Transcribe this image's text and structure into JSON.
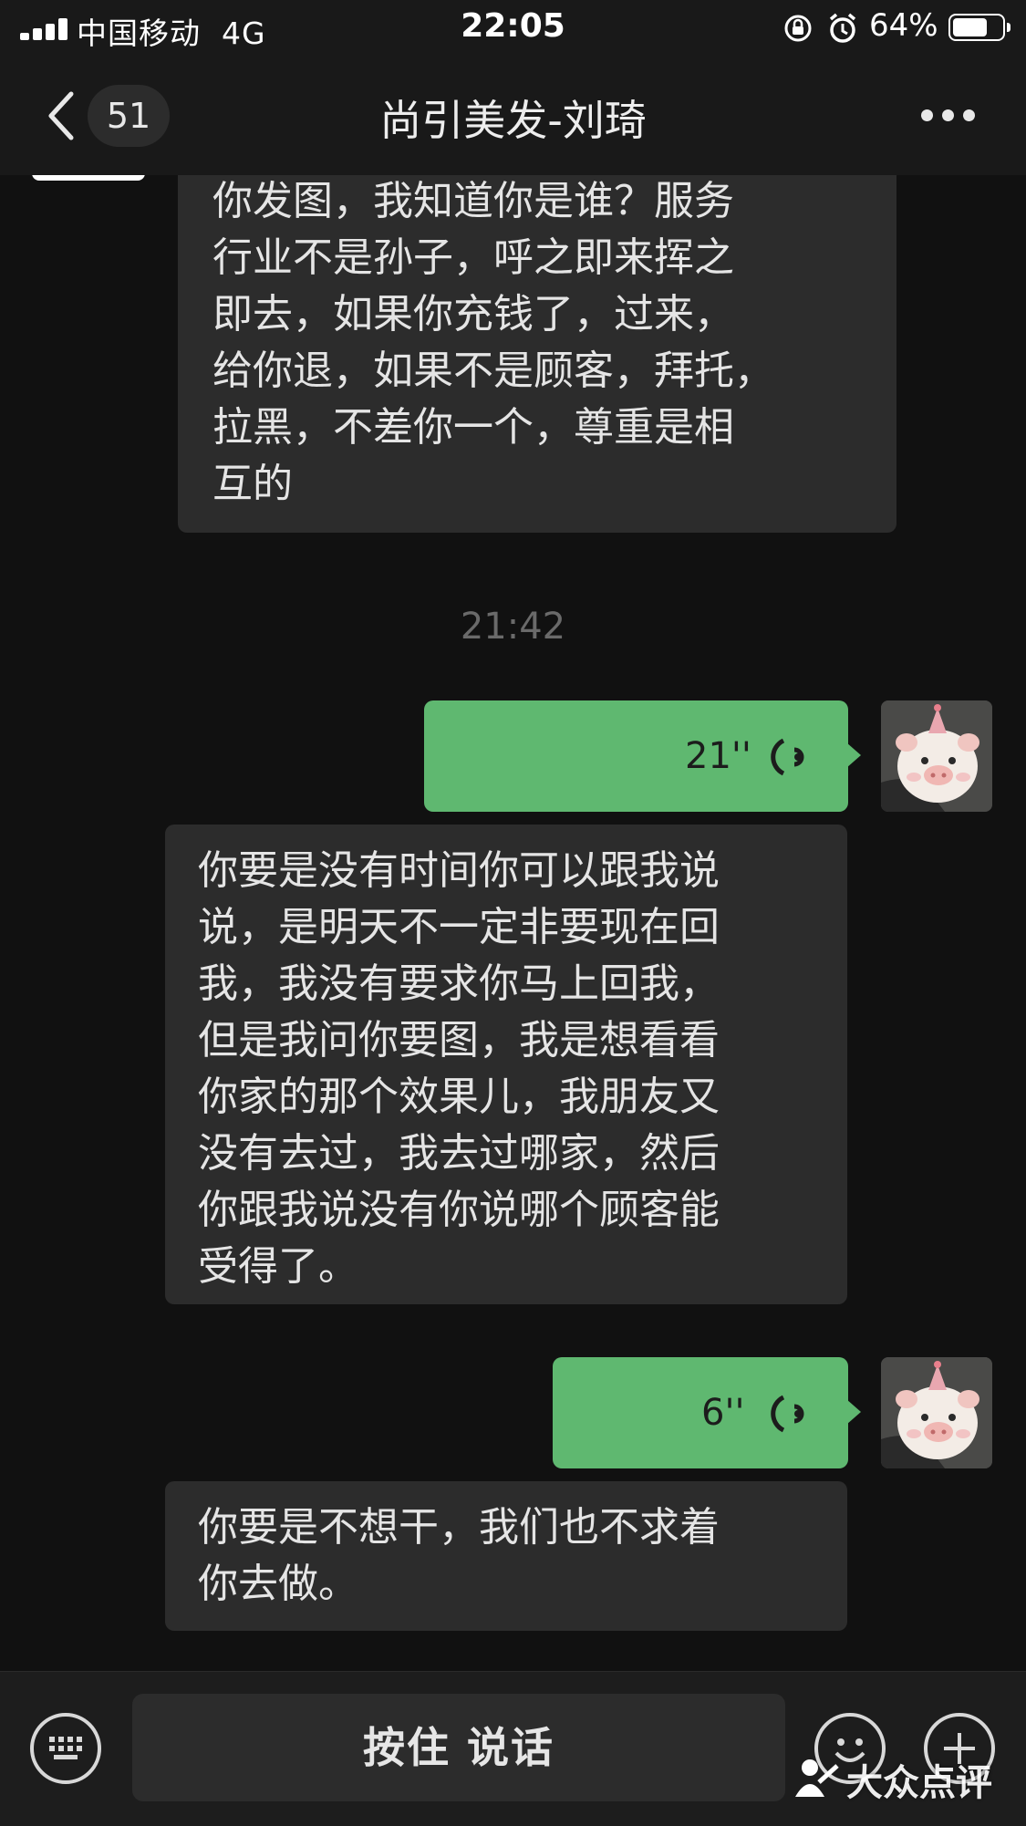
{
  "status_bar": {
    "carrier": "中国移动",
    "network": "4G",
    "time": "22:05",
    "battery_percent": "64%",
    "battery_level": 0.64
  },
  "header": {
    "unread_count": "51",
    "title": "尚引美发-刘琦",
    "icons": [
      "chevron-left-icon",
      "more-dots-icon"
    ]
  },
  "messages": [
    {
      "side": "left",
      "type": "text",
      "text": "你发图，我知道你是谁？服务\n行业不是孙子，呼之即来挥之\n即去，如果你充钱了，过来，\n给你退，如果不是顾客，拜托，\n拉黑，不差你一个，尊重是相\n互的"
    },
    {
      "type": "timestamp",
      "text": "21:42"
    },
    {
      "side": "right",
      "type": "voice",
      "duration": "21''"
    },
    {
      "side": "left",
      "type": "text",
      "text": "你要是没有时间你可以跟我说\n说，是明天不一定非要现在回\n我，我没有要求你马上回我，\n但是我问你要图，我是想看看\n你家的那个效果儿，我朋友又\n没有去过，我去过哪家，然后\n你跟我说没有你说哪个顾客能\n受得了。"
    },
    {
      "side": "right",
      "type": "voice",
      "duration": "6''"
    },
    {
      "side": "left",
      "type": "text",
      "text": "你要是不想干，我们也不求着\n你去做。"
    }
  ],
  "input_bar": {
    "hold_to_talk_label": "按住 说话",
    "icons": [
      "keyboard-icon",
      "emoji-icon",
      "plus-icon"
    ]
  },
  "watermark": "大众点评",
  "colors": {
    "background": "#111111",
    "bar": "#191919",
    "incoming_bubble": "#2c2c2c",
    "outgoing_bubble": "#5fb870",
    "timestamp": "#6a6a6a"
  }
}
